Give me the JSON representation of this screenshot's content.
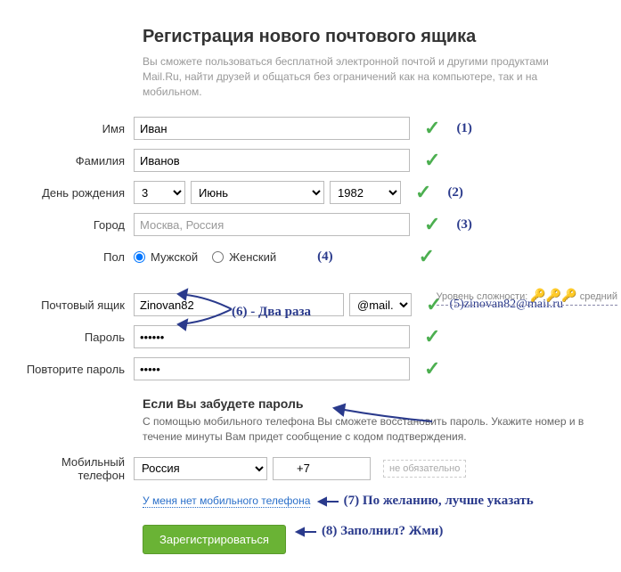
{
  "header": {
    "title": "Регистрация нового почтового ящика",
    "subtitle": "Вы сможете пользоваться бесплатной электронной почтой и другими продуктами Mail.Ru, найти друзей и общаться без ограничений как на компьютере, так и на мобильном."
  },
  "labels": {
    "firstname": "Имя",
    "lastname": "Фамилия",
    "birthday": "День рождения",
    "city": "Город",
    "gender": "Пол",
    "mailbox": "Почтовый ящик",
    "password": "Пароль",
    "password2": "Повторите пароль",
    "phone": "Мобильный телефон"
  },
  "values": {
    "firstname": "Иван",
    "lastname": "Иванов",
    "day": "3",
    "month": "Июнь",
    "year": "1982",
    "city": "Москва, Россия",
    "mailbox": "Zinovan82",
    "domain": "@mail.ru",
    "password": "••••••",
    "password2": "•••••",
    "country": "Россия",
    "phone": "+7"
  },
  "gender": {
    "male": "Мужской",
    "female": "Женский"
  },
  "recovery": {
    "title": "Если Вы забудете пароль",
    "desc": "С помощью мобильного телефона Вы сможете восстановить пароль. Укажите номер и в течение минуты Вам придет сообщение с кодом подтверждения.",
    "optional": "не обязательно",
    "no_phone_link": "У меня нет мобильного телефона"
  },
  "strength": {
    "label": "Уровень сложности:",
    "value": "средний"
  },
  "submit": "Зарегистрироваться",
  "annotations": {
    "a1": "(1)",
    "a2": "(2)",
    "a3": "(3)",
    "a4": "(4)",
    "a5": "(5)",
    "a5email": "zinovan82@mail.ru",
    "a6": "(6) - Два раза",
    "a7": "(7) По желанию, лучше указать",
    "a8": "(8) Заполнил? Жми)"
  }
}
